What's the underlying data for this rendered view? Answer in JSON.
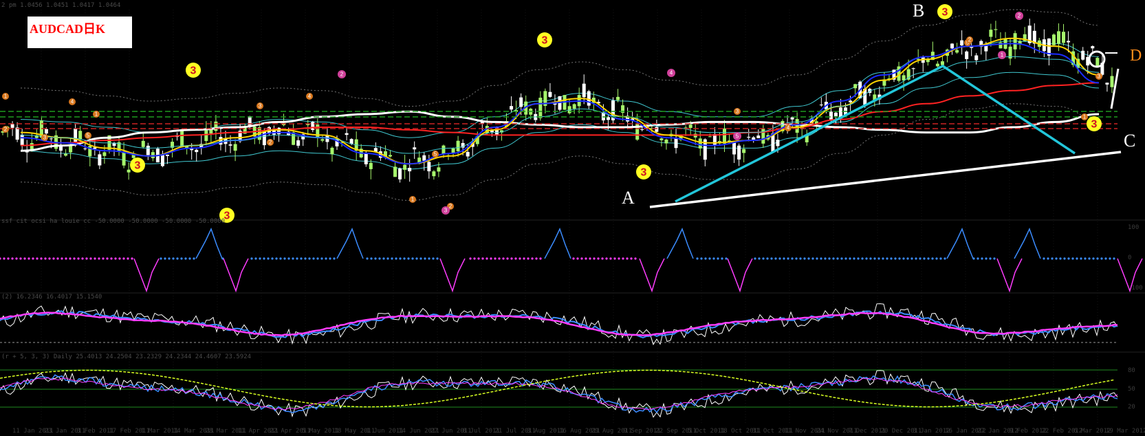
{
  "chart_data": {
    "type": "line",
    "title": "AUDCAD日K",
    "panels": [
      {
        "name": "price",
        "header": "2 pm   1.0456 1.0451 1.0417 1.0464",
        "series": [
          {
            "color": "#ffffff",
            "kind": "moving-average",
            "values": [
              1.041,
              1.043,
              1.046,
              1.048,
              1.049,
              1.05,
              1.052,
              1.054,
              1.055,
              1.056,
              1.054,
              1.052,
              1.051,
              1.05,
              1.05,
              1.051,
              1.052,
              1.052,
              1.051,
              1.05,
              1.049,
              1.048,
              1.048,
              1.05,
              1.052,
              1.055
            ]
          },
          {
            "color": "#ff2222",
            "kind": "moving-average",
            "values": [
              1.043,
              1.044,
              1.045,
              1.046,
              1.047,
              1.048,
              1.049,
              1.05,
              1.05,
              1.049,
              1.048,
              1.047,
              1.047,
              1.047,
              1.047,
              1.047,
              1.047,
              1.048,
              1.05,
              1.053,
              1.056,
              1.059,
              1.062,
              1.064,
              1.066,
              1.067
            ]
          },
          {
            "color": "#ffd400",
            "kind": "moving-average",
            "values": [
              1.048,
              1.046,
              1.042,
              1.039,
              1.043,
              1.046,
              1.049,
              1.047,
              1.041,
              1.036,
              1.039,
              1.049,
              1.059,
              1.061,
              1.054,
              1.047,
              1.044,
              1.045,
              1.05,
              1.058,
              1.068,
              1.076,
              1.081,
              1.084,
              1.081,
              1.07
            ]
          },
          {
            "color": "#1a2bff",
            "kind": "moving-average",
            "values": [
              1.046,
              1.044,
              1.041,
              1.039,
              1.042,
              1.045,
              1.048,
              1.046,
              1.04,
              1.036,
              1.04,
              1.05,
              1.059,
              1.06,
              1.053,
              1.046,
              1.043,
              1.045,
              1.051,
              1.06,
              1.07,
              1.077,
              1.081,
              1.082,
              1.078,
              1.067
            ]
          },
          {
            "color": "#40c8d0",
            "kind": "moving-average",
            "values": [
              1.047,
              1.046,
              1.044,
              1.042,
              1.043,
              1.045,
              1.047,
              1.046,
              1.043,
              1.04,
              1.042,
              1.048,
              1.054,
              1.057,
              1.054,
              1.05,
              1.048,
              1.048,
              1.052,
              1.058,
              1.065,
              1.071,
              1.075,
              1.077,
              1.076,
              1.071
            ]
          }
        ]
      },
      {
        "name": "oscillator-1",
        "header": "ssf cit ocsi ha louie cc  -50.0000 -50.0000 -50.0000 -50.0000"
      },
      {
        "name": "oscillator-2",
        "header": "(2) 16.2346 16.4017 15.1540"
      },
      {
        "name": "oscillator-3",
        "header": "(r + 5, 3, 3) Daily 25.4013 24.2504 23.2329 24.2344 24.4607 23.5924"
      }
    ],
    "x_tick_labels": [
      "11 Jan 2011",
      "23 Jan 2011",
      "3 Feb 2011",
      "17 Feb 2011",
      "1 Mar 2011",
      "14 Mar 2011",
      "28 Mar 2011",
      "11 Apr 2011",
      "22 Apr 2011",
      "5 May 2011",
      "18 May 2011",
      "1 Jun 2011",
      "14 Jun 2011",
      "27 Jun 2011",
      "8 Jul 2011",
      "21 Jul 2011",
      "3 Aug 2011",
      "16 Aug 2011",
      "29 Aug 2011",
      "9 Sep 2011",
      "22 Sep 2011",
      "5 Oct 2011",
      "18 Oct 2011",
      "31 Oct 2011",
      "11 Nov 2011",
      "24 Nov 2011",
      "7 Dec 2011",
      "20 Dec 2011",
      "3 Jan 2012",
      "16 Jan 2012",
      "27 Jan 2012",
      "9 Feb 2012",
      "22 Feb 2012",
      "6 Mar 2012",
      "19 Mar 2012"
    ],
    "right_axis_labels": [
      "100",
      "0",
      "-100",
      "80",
      "50",
      "20"
    ],
    "annotations": {
      "points": [
        "A",
        "B",
        "C",
        "D"
      ],
      "badges": [
        "3",
        "3",
        "3",
        "3",
        "3",
        "3",
        "3",
        "3",
        "3",
        "3",
        "3"
      ],
      "small_markers": [
        "1",
        "2",
        "3",
        "4",
        "5"
      ]
    },
    "colors": {
      "background": "#000000",
      "bull_candle": "#a6f56c",
      "bear_candle": "#ffffff",
      "ma_white": "#ffffff",
      "ma_red": "#ff2222",
      "ma_yellow": "#ffd400",
      "ma_blue": "#1a2bff",
      "band_cyan": "#40c8d0",
      "trendline_cyan": "#22c6da",
      "trendline_white": "#ffffff",
      "osc_magenta": "#ff3cff",
      "osc_blue": "#3b8cff",
      "level_green": "#1f8a1f"
    }
  }
}
